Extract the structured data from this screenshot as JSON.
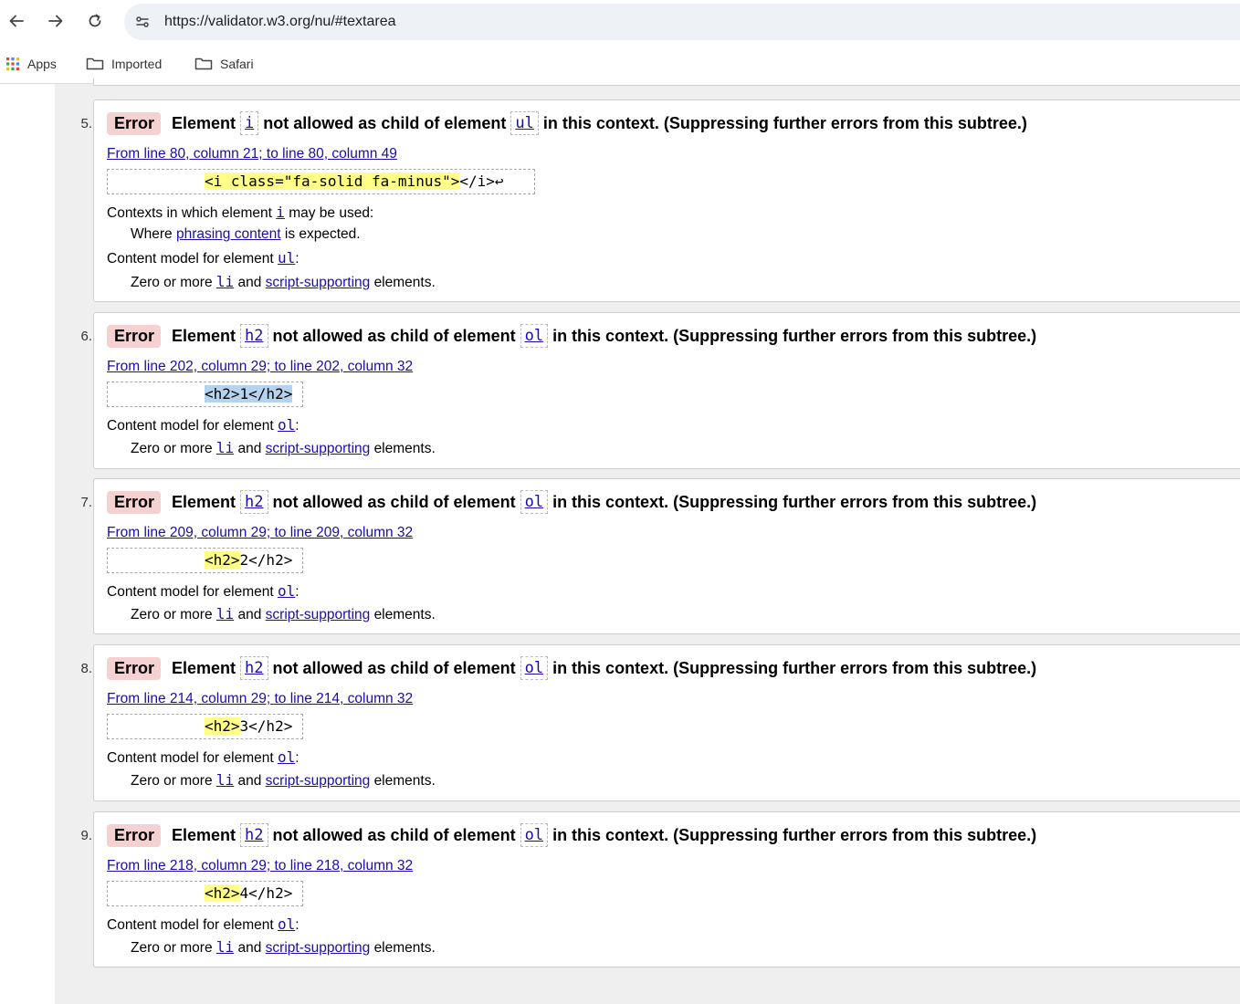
{
  "browser": {
    "url": "https://validator.w3.org/nu/#textarea",
    "bookmarks": [
      "Apps",
      "Imported",
      "Safari"
    ]
  },
  "messages": [
    {
      "num": "5.",
      "badge": "Error",
      "word_element": "Element",
      "child": "i",
      "mid": "not allowed as child of element",
      "parent": "ul",
      "tail": "in this context. (Suppressing further errors from this subtree.)",
      "location": "From line 80, column 21; to line 80, column 49",
      "extract_highlight": "<i class=\"fa-solid fa-minus\">",
      "extract_rest": "</i>↩",
      "contexts": {
        "prefix": "Contexts in which element",
        "code": "i",
        "suffix": "may be used:",
        "where_prefix": "Where",
        "where_link": "phrasing content",
        "where_suffix": "is expected."
      },
      "model_prefix": "Content model for element",
      "model_code": "ul",
      "model_suffix": ":",
      "zero_prefix": "Zero or more",
      "zero_code": "li",
      "zero_and": "and",
      "zero_link": "script-supporting",
      "zero_suffix": "elements."
    },
    {
      "num": "6.",
      "badge": "Error",
      "word_element": "Element",
      "child": "h2",
      "mid": "not allowed as child of element",
      "parent": "ol",
      "tail": "in this context. (Suppressing further errors from this subtree.)",
      "location": "From line 202, column 29; to line 202, column 32",
      "extract_highlight": "<h2>1</h2>",
      "extract_rest": "",
      "model_prefix": "Content model for element",
      "model_code": "ol",
      "model_suffix": ":",
      "zero_prefix": "Zero or more",
      "zero_code": "li",
      "zero_and": "and",
      "zero_link": "script-supporting",
      "zero_suffix": "elements."
    },
    {
      "num": "7.",
      "badge": "Error",
      "word_element": "Element",
      "child": "h2",
      "mid": "not allowed as child of element",
      "parent": "ol",
      "tail": "in this context. (Suppressing further errors from this subtree.)",
      "location": "From line 209, column 29; to line 209, column 32",
      "extract_highlight": "<h2>",
      "extract_rest": "2</h2>",
      "model_prefix": "Content model for element",
      "model_code": "ol",
      "model_suffix": ":",
      "zero_prefix": "Zero or more",
      "zero_code": "li",
      "zero_and": "and",
      "zero_link": "script-supporting",
      "zero_suffix": "elements."
    },
    {
      "num": "8.",
      "badge": "Error",
      "word_element": "Element",
      "child": "h2",
      "mid": "not allowed as child of element",
      "parent": "ol",
      "tail": "in this context. (Suppressing further errors from this subtree.)",
      "location": "From line 214, column 29; to line 214, column 32",
      "extract_highlight": "<h2>",
      "extract_rest": "3</h2>",
      "model_prefix": "Content model for element",
      "model_code": "ol",
      "model_suffix": ":",
      "zero_prefix": "Zero or more",
      "zero_code": "li",
      "zero_and": "and",
      "zero_link": "script-supporting",
      "zero_suffix": "elements."
    },
    {
      "num": "9.",
      "badge": "Error",
      "word_element": "Element",
      "child": "h2",
      "mid": "not allowed as child of element",
      "parent": "ol",
      "tail": "in this context. (Suppressing further errors from this subtree.)",
      "location": "From line 218, column 29; to line 218, column 32",
      "extract_highlight": "<h2>",
      "extract_rest": "4</h2>",
      "model_prefix": "Content model for element",
      "model_code": "ol",
      "model_suffix": ":",
      "zero_prefix": "Zero or more",
      "zero_code": "li",
      "zero_and": "and",
      "zero_link": "script-supporting",
      "zero_suffix": "elements."
    }
  ]
}
